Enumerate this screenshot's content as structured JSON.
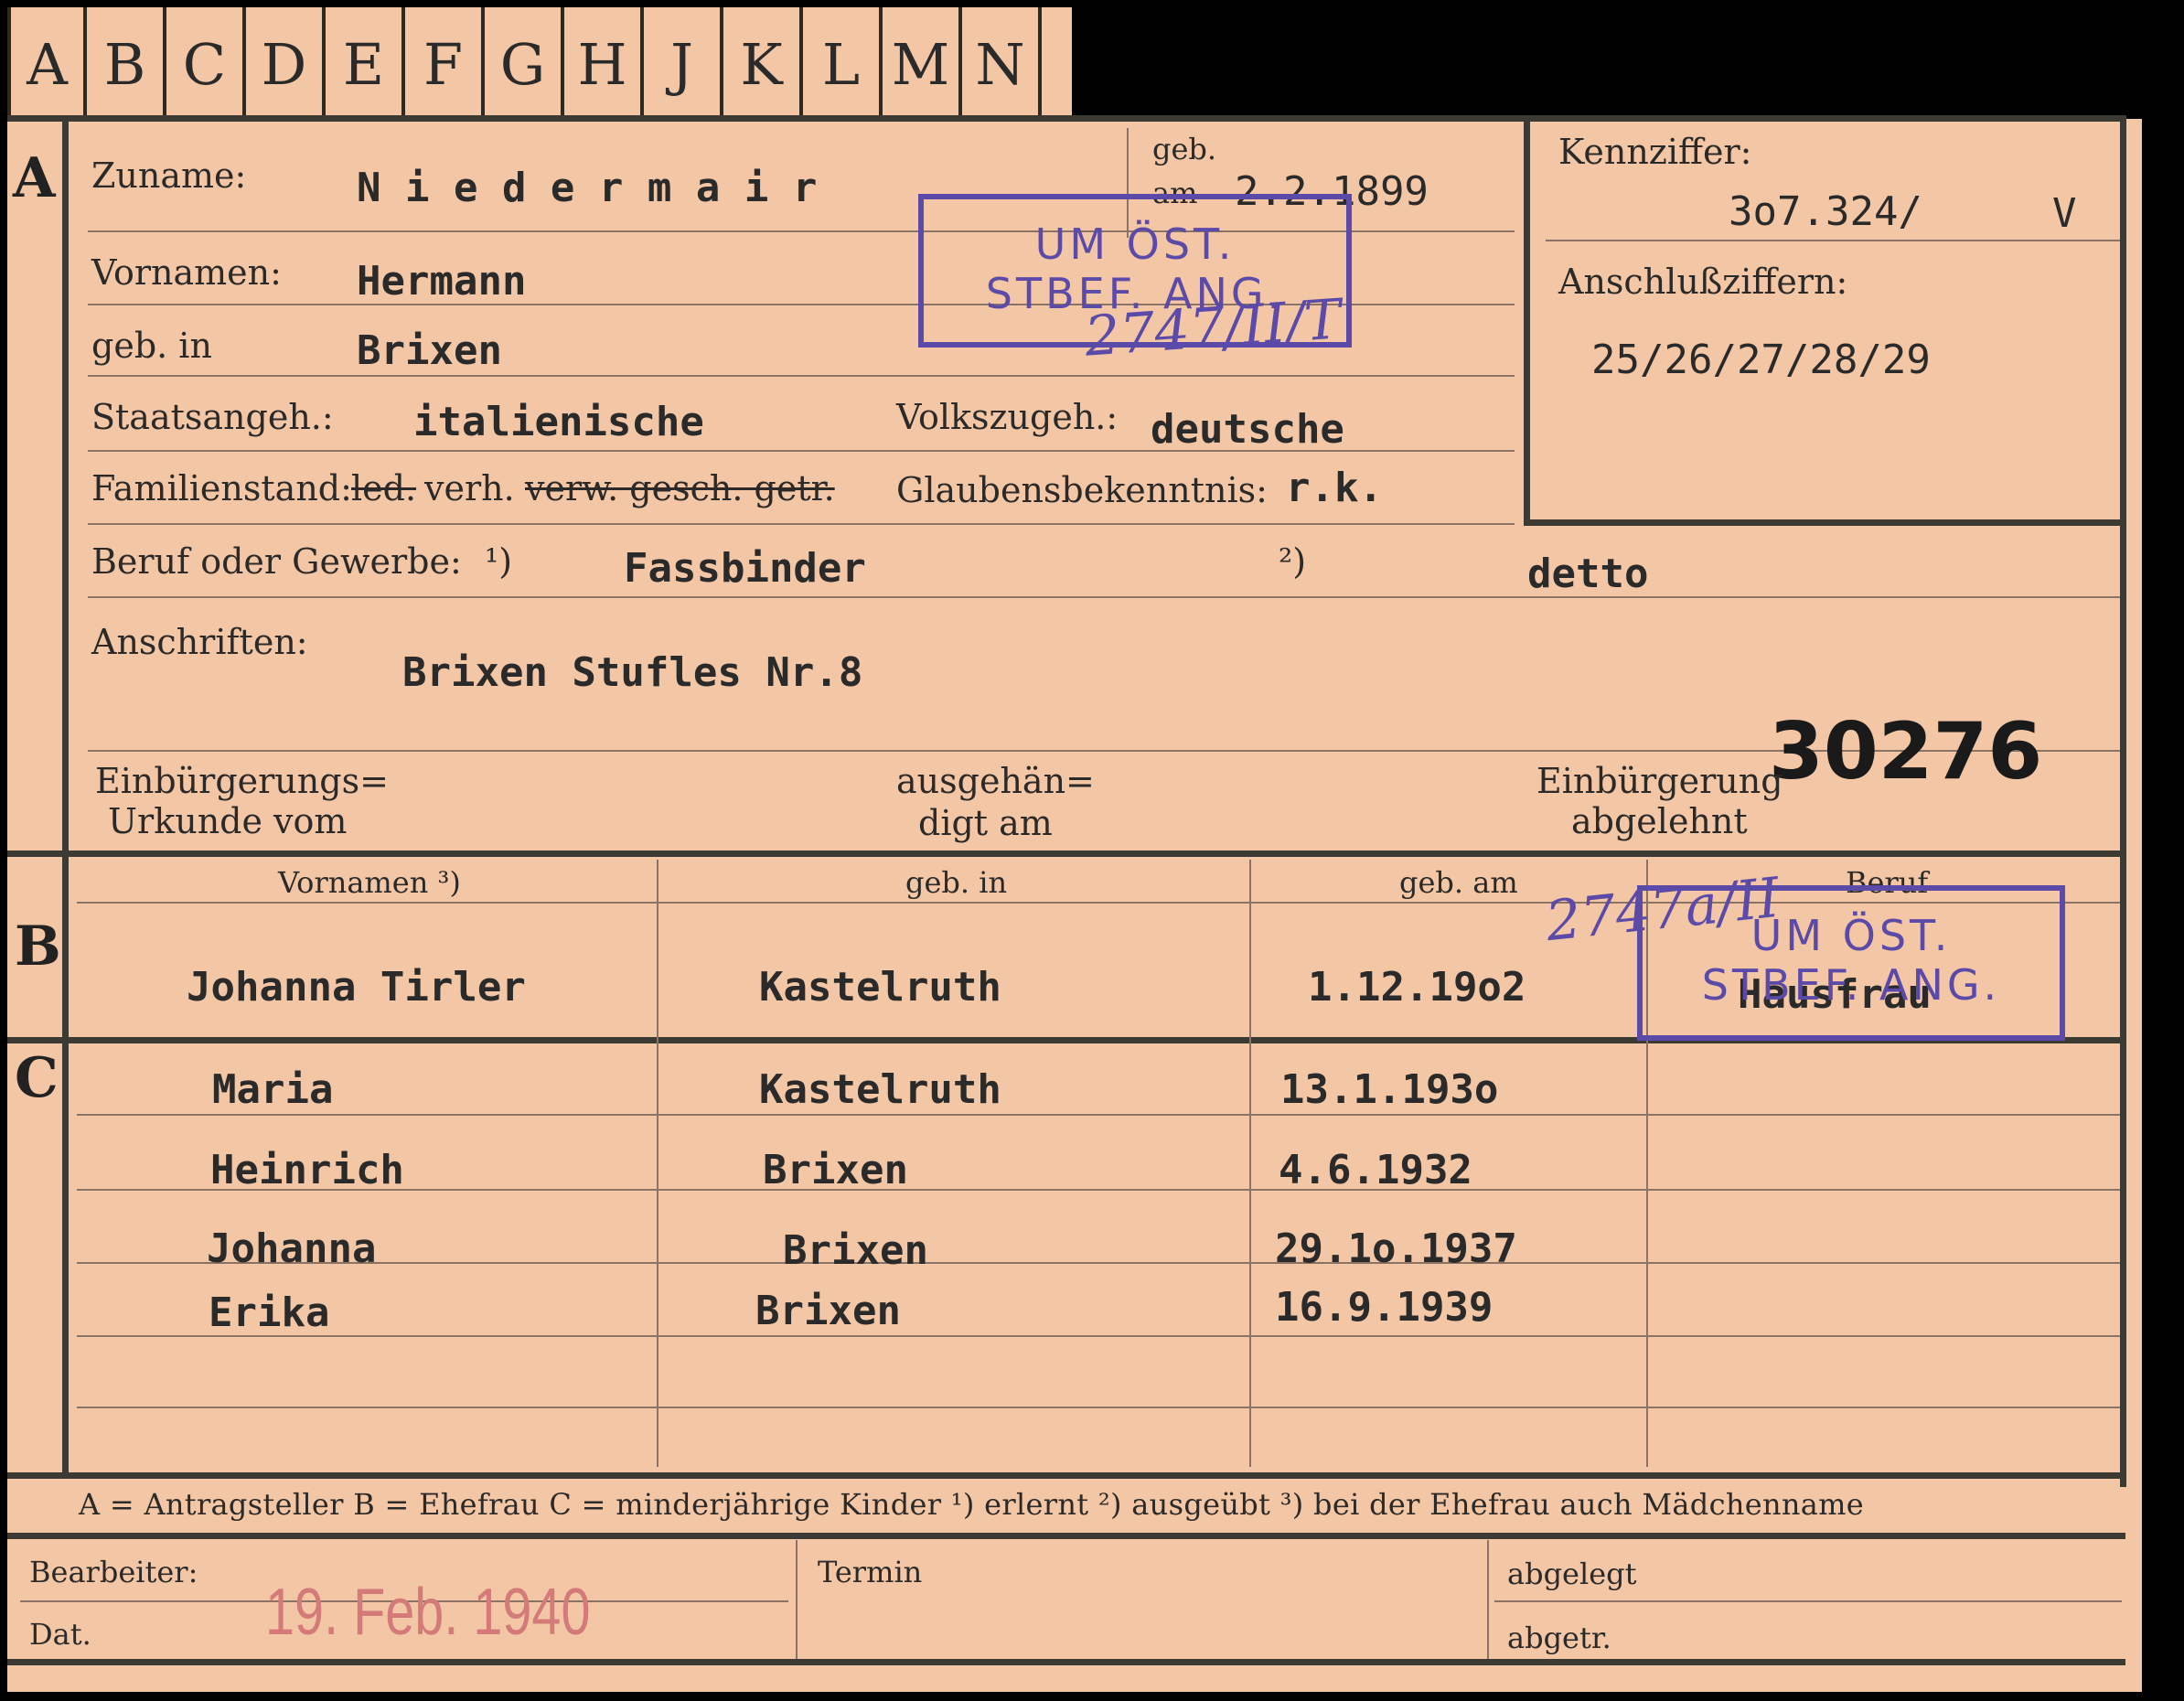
{
  "tabs": [
    "A",
    "B",
    "C",
    "D",
    "E",
    "F",
    "G",
    "H",
    "J",
    "K",
    "L",
    "M",
    "N"
  ],
  "sections": {
    "a": "A",
    "b": "B",
    "c": "C"
  },
  "labels": {
    "zuname": "Zuname:",
    "vornamen": "Vornamen:",
    "geb_in": "geb. in",
    "geb": "geb.",
    "am": "am",
    "staatsangeh": "Staatsangeh.:",
    "volkszugeh": "Volkszugeh.:",
    "familienstand": "Familienstand:",
    "fam_led": "led.",
    "fam_verh": "verh.",
    "fam_rest": "verw. gesch. getr.",
    "glaubens": "Glaubensbekenntnis:",
    "beruf": "Beruf oder Gewerbe:",
    "fn1": "¹)",
    "fn2": "²)",
    "anschriften": "Anschriften:",
    "einb_urk_1": "Einbürgerungs=",
    "einb_urk_2": "Urkunde vom",
    "ausgeh_1": "ausgehän=",
    "ausgeh_2": "digt am",
    "einb_abg_1": "Einbürgerung",
    "einb_abg_2": "abgelehnt",
    "kennziffer": "Kennziffer:",
    "anschluss": "Anschlußziffern:",
    "col_vornamen": "Vornamen ³)",
    "col_geb_in": "geb. in",
    "col_geb_am": "geb. am",
    "col_beruf": "Beruf",
    "legend": "A = Antragsteller   B = Ehefrau   C = minderjährige Kinder   ¹) erlernt   ²) ausgeübt   ³) bei der Ehefrau auch Mädchenname",
    "bearbeiter": "Bearbeiter:",
    "dat": "Dat.",
    "termin": "Termin",
    "abgelegt": "abgelegt",
    "abgetr": "abgetr."
  },
  "applicant": {
    "zuname": "N i e d e r m a i r",
    "geb_am": "2.2.1899",
    "vornamen": "Hermann",
    "geb_in": "Brixen",
    "staatsangeh": "italienische",
    "volkszugeh": "deutsche",
    "glaubens": "r.k.",
    "beruf_erlernt": "Fassbinder",
    "beruf_ausgeuebt": "detto",
    "anschrift": "Brixen Stufles Nr.8",
    "kennziffer": "3o7.324/",
    "kennziffer_suffix": "V",
    "anschlussziffern": "25/26/27/28/29",
    "number": "30276"
  },
  "stamp_a": {
    "line1": "UM ÖST.",
    "line2": "STBEF. ANG.",
    "handwritten": "2747/II/T"
  },
  "stamp_b": {
    "line1": "UM ÖST.",
    "line2": "STBEF. ANG.",
    "handwritten": "2747a/II"
  },
  "spouse": {
    "vornamen": "Johanna Tirler",
    "geb_in": "Kastelruth",
    "geb_am": "1.12.19o2",
    "beruf": "Hausfrau"
  },
  "children": [
    {
      "vornamen": "Maria",
      "geb_in": "Kastelruth",
      "geb_am": "13.1.193o"
    },
    {
      "vornamen": "Heinrich",
      "geb_in": "Brixen",
      "geb_am": "4.6.1932"
    },
    {
      "vornamen": "Johanna",
      "geb_in": "Brixen",
      "geb_am": "29.1o.1937"
    },
    {
      "vornamen": "Erika",
      "geb_in": "Brixen",
      "geb_am": "16.9.1939"
    }
  ],
  "footer": {
    "date_stamp": "19. Feb. 1940"
  }
}
